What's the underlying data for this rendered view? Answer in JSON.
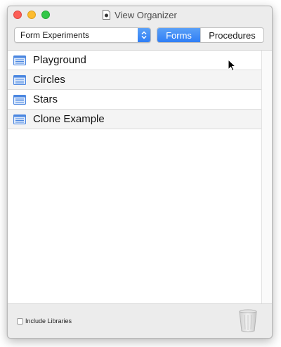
{
  "window": {
    "title": "View Organizer"
  },
  "toolbar": {
    "project_select_value": "Form Experiments",
    "segments": {
      "forms_label": "Forms",
      "procedures_label": "Procedures",
      "selected": "Forms"
    }
  },
  "list": {
    "items": [
      {
        "label": "Playground",
        "icon": "form-icon"
      },
      {
        "label": "Circles",
        "icon": "form-icon"
      },
      {
        "label": "Stars",
        "icon": "form-icon"
      },
      {
        "label": "Clone Example",
        "icon": "form-icon"
      }
    ]
  },
  "footer": {
    "include_libraries_label": "Include Libraries",
    "include_libraries_checked": false,
    "trash_icon": "trash-icon"
  },
  "colors": {
    "accent": "#2f7ef5",
    "close": "#fc5f57",
    "minimize": "#fdbc2e",
    "maximize": "#33c748"
  }
}
